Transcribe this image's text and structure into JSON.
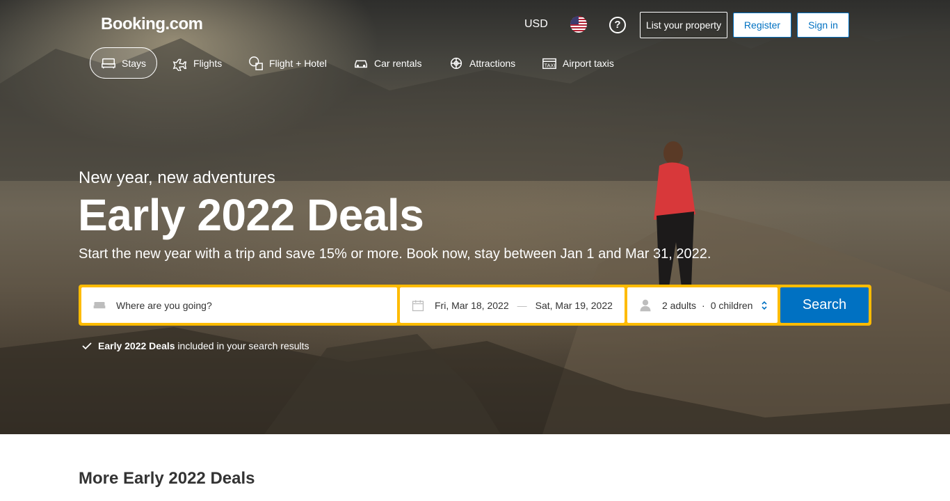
{
  "header": {
    "logo": "Booking.com",
    "currency": "USD",
    "language_flag": "us-flag-icon",
    "help_icon": "help-icon",
    "list_property_label": "List your property",
    "register_label": "Register",
    "sign_in_label": "Sign in"
  },
  "nav": {
    "items": [
      {
        "label": "Stays",
        "icon": "bed-icon",
        "active": true
      },
      {
        "label": "Flights",
        "icon": "plane-icon",
        "active": false
      },
      {
        "label": "Flight + Hotel",
        "icon": "flight-hotel-icon",
        "active": false
      },
      {
        "label": "Car rentals",
        "icon": "car-icon",
        "active": false
      },
      {
        "label": "Attractions",
        "icon": "attractions-icon",
        "active": false
      },
      {
        "label": "Airport taxis",
        "icon": "taxi-icon",
        "active": false
      }
    ]
  },
  "hero": {
    "subtitle": "New year, new adventures",
    "title": "Early 2022 Deals",
    "description": "Start the new year with a trip and save 15% or more. Book now, stay between Jan 1 and Mar 31, 2022."
  },
  "search": {
    "destination_placeholder": "Where are you going?",
    "checkin": "Fri, Mar 18, 2022",
    "date_separator": "—",
    "checkout": "Sat, Mar 19, 2022",
    "adults": "2 adults",
    "guest_separator": "·",
    "children": "0 children",
    "button_label": "Search"
  },
  "note": {
    "bold": "Early 2022 Deals",
    "rest": "included in your search results"
  },
  "section": {
    "title": "More Early 2022 Deals"
  },
  "colors": {
    "brand_blue": "#0071c2",
    "search_border": "#febb02"
  }
}
